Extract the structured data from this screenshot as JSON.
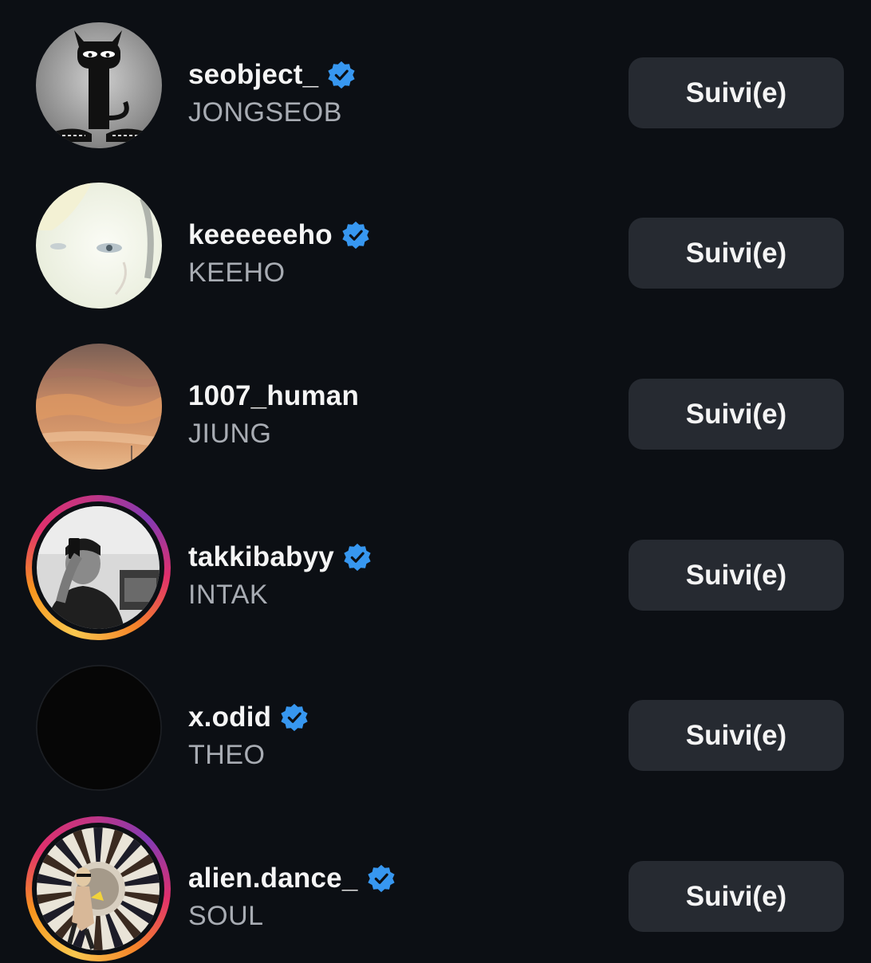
{
  "follow_list": [
    {
      "username": "seobject_",
      "full_name": "JONGSEOB",
      "verified": true,
      "has_story": false,
      "avatar": "black-cat-cartoon",
      "button_label": "Suivi(e)"
    },
    {
      "username": "keeeeeeho",
      "full_name": "KEEHO",
      "verified": true,
      "has_story": false,
      "avatar": "bright-face-closeup",
      "button_label": "Suivi(e)"
    },
    {
      "username": "1007_human",
      "full_name": "JIUNG",
      "verified": false,
      "has_story": false,
      "avatar": "sunset-clouds",
      "button_label": "Suivi(e)"
    },
    {
      "username": "takkibabyy",
      "full_name": "INTAK",
      "verified": true,
      "has_story": true,
      "avatar": "mirror-selfie-bw",
      "button_label": "Suivi(e)"
    },
    {
      "username": "x.odid",
      "full_name": "THEO",
      "verified": true,
      "has_story": false,
      "avatar": "black-image",
      "button_label": "Suivi(e)"
    },
    {
      "username": "alien.dance_",
      "full_name": "SOUL",
      "verified": true,
      "has_story": true,
      "avatar": "psychedelic-spiral",
      "button_label": "Suivi(e)"
    }
  ],
  "colors": {
    "background": "#0c0f14",
    "button_bg": "#262a31",
    "username": "#f5f5f5",
    "full_name": "#a8acb3",
    "verified_badge": "#3797f0"
  }
}
